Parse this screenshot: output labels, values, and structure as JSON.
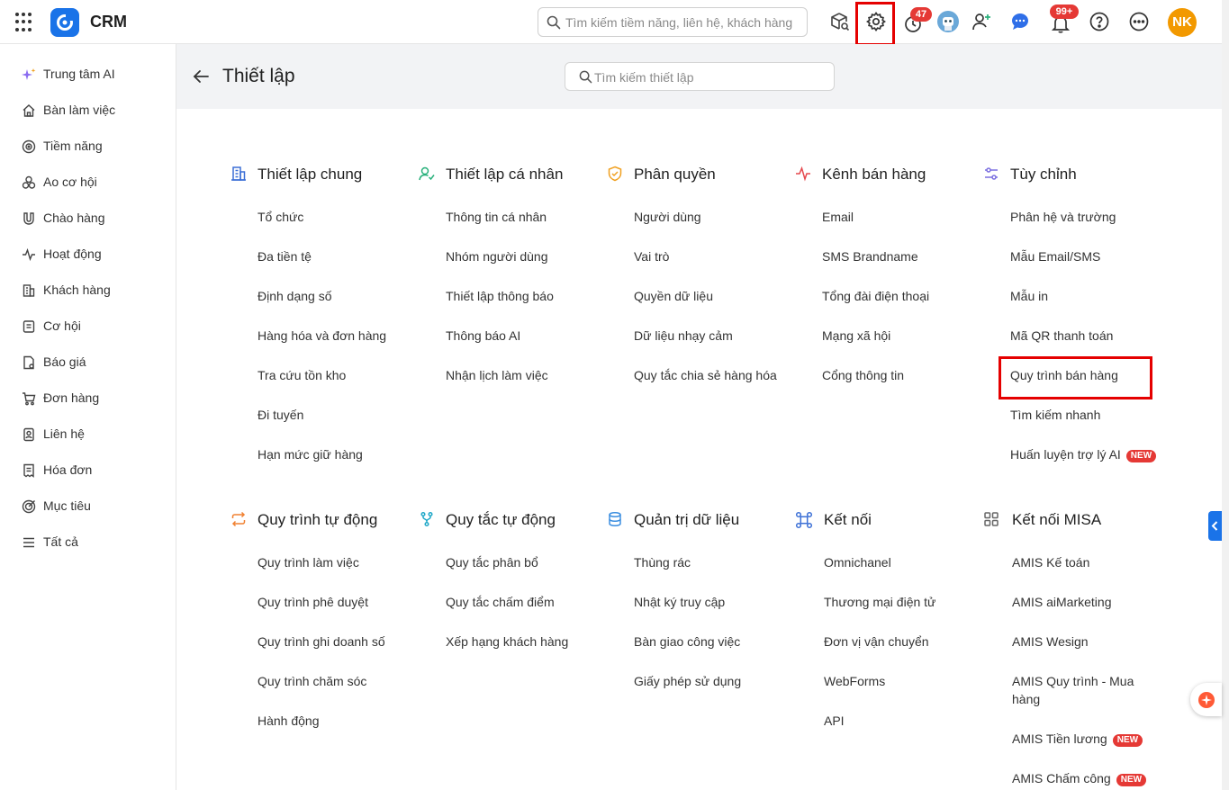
{
  "app": {
    "name": "CRM"
  },
  "topbar": {
    "search_placeholder": "Tìm kiếm tiềm năng, liên hệ, khách hàng",
    "reminder_count": "47",
    "notification_count": "99+",
    "user_initials": "NK",
    "icons": [
      "apps-grid-icon",
      "package-search-icon",
      "gear-icon",
      "timer-icon",
      "robot-avatar-icon",
      "add-user-icon",
      "chat-icon",
      "bell-icon",
      "help-icon",
      "more-icon"
    ]
  },
  "sidebar": {
    "items": [
      {
        "label": "Trung tâm AI",
        "icon": "sparkle-icon"
      },
      {
        "label": "Bàn làm việc",
        "icon": "home-icon"
      },
      {
        "label": "Tiềm năng",
        "icon": "target-icon"
      },
      {
        "label": "Ao cơ hội",
        "icon": "pool-icon"
      },
      {
        "label": "Chào hàng",
        "icon": "magnet-icon"
      },
      {
        "label": "Hoạt động",
        "icon": "activity-icon"
      },
      {
        "label": "Khách hàng",
        "icon": "building-icon"
      },
      {
        "label": "Cơ hội",
        "icon": "document-icon"
      },
      {
        "label": "Báo giá",
        "icon": "quote-icon"
      },
      {
        "label": "Đơn hàng",
        "icon": "cart-icon"
      },
      {
        "label": "Liên hệ",
        "icon": "contact-icon"
      },
      {
        "label": "Hóa đơn",
        "icon": "invoice-icon"
      },
      {
        "label": "Mục tiêu",
        "icon": "goal-icon"
      },
      {
        "label": "Tất cả",
        "icon": "menu-icon"
      }
    ]
  },
  "page": {
    "title": "Thiết lập",
    "search_placeholder": "Tìm kiếm thiết lập"
  },
  "sections": [
    {
      "title": "Thiết lập chung",
      "icon": "building-icon",
      "color": "#3b6fd6",
      "items": [
        "Tổ chức",
        "Đa tiền tệ",
        "Định dạng số",
        "Hàng hóa và đơn hàng",
        "Tra cứu tồn kho",
        "Đi tuyến",
        "Hạn mức giữ hàng"
      ]
    },
    {
      "title": "Thiết lập cá nhân",
      "icon": "user-check-icon",
      "color": "#27b07a",
      "items": [
        "Thông tin cá nhân",
        "Nhóm người dùng",
        "Thiết lập thông báo",
        "Thông báo AI",
        "Nhận lịch làm việc"
      ]
    },
    {
      "title": "Phân quyền",
      "icon": "shield-icon",
      "color": "#f0a020",
      "items": [
        "Người dùng",
        "Vai trò",
        "Quyền dữ liệu",
        "Dữ liệu nhạy cảm",
        "Quy tắc chia sẻ hàng hóa"
      ]
    },
    {
      "title": "Kênh bán hàng",
      "icon": "pulse-icon",
      "color": "#e5484d",
      "items": [
        "Email",
        "SMS Brandname",
        "Tổng đài điện thoại",
        "Mạng xã hội",
        "Cổng thông tin"
      ]
    },
    {
      "title": "Tùy chỉnh",
      "icon": "sliders-icon",
      "color": "#7b6fe0",
      "items": [
        "Phân hệ và trường",
        "Mẫu Email/SMS",
        "Mẫu in",
        "Mã QR thanh toán",
        "Quy trình bán hàng",
        "Tìm kiếm nhanh",
        "Huấn luyện trợ lý AI"
      ],
      "new_badge": "NEW"
    },
    {
      "title": "Quy trình tự động",
      "icon": "repeat-icon",
      "color": "#f08030",
      "items": [
        "Quy trình làm việc",
        "Quy trình phê duyệt",
        "Quy trình ghi doanh số",
        "Quy trình chăm sóc",
        "Hành động"
      ]
    },
    {
      "title": "Quy tắc tự động",
      "icon": "branch-icon",
      "color": "#20a8c8",
      "items": [
        "Quy tắc phân bổ",
        "Quy tắc chấm điểm",
        "Xếp hạng khách hàng"
      ]
    },
    {
      "title": "Quản trị dữ liệu",
      "icon": "database-icon",
      "color": "#3b8ee0",
      "items": [
        "Thùng rác",
        "Nhật ký truy cập",
        "Bàn giao công việc",
        "Giấy phép sử dụng"
      ]
    },
    {
      "title": "Kết nối",
      "icon": "connect-icon",
      "color": "#3b6fd6",
      "items": [
        "Omnichanel",
        "Thương mại điện tử",
        "Đơn vị vận chuyển",
        "WebForms",
        "API"
      ]
    },
    {
      "title": "Kết nối MISA",
      "icon": "grid-icon",
      "color": "#666666",
      "items": [
        "AMIS Kế toán",
        "AMIS aiMarketing",
        "AMIS Wesign",
        "AMIS Quy trình - Mua hàng",
        "AMIS Tiền lương",
        "AMIS Chấm công"
      ],
      "new_badge": "NEW"
    }
  ]
}
